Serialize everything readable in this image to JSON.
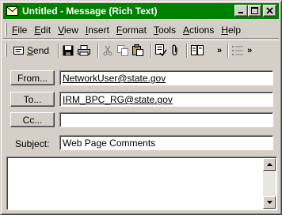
{
  "window": {
    "title": "Untitled - Message (Rich Text)",
    "accent_color": "#008000",
    "controls": {
      "minimize": "_",
      "maximize": "□",
      "close": "×"
    }
  },
  "menu": [
    {
      "key": "file",
      "accel": "F",
      "rest": "ile"
    },
    {
      "key": "edit",
      "accel": "E",
      "rest": "dit"
    },
    {
      "key": "view",
      "accel": "V",
      "rest": "iew"
    },
    {
      "key": "insert",
      "accel": "I",
      "rest": "nsert"
    },
    {
      "key": "format",
      "accel": "F",
      "rest": "ormat"
    },
    {
      "key": "tools",
      "accel": "T",
      "rest": "ools"
    },
    {
      "key": "actions",
      "accel": "A",
      "rest": "ctions"
    },
    {
      "key": "help",
      "accel": "H",
      "rest": "elp"
    }
  ],
  "toolbar": {
    "send_accel": "S",
    "send_rest": "end",
    "overflow_glyph": "»",
    "icons": [
      "save-icon",
      "print-icon",
      "cut-icon",
      "copy-icon",
      "paste-icon",
      "check-names-icon",
      "attach-icon",
      "address-book-icon",
      "bullets-icon"
    ]
  },
  "fields": {
    "from": {
      "button_label": "From...",
      "value": "NetworkUser@state.gov"
    },
    "to": {
      "button_label": "To...",
      "value": "IRM_BPC_RG@state.gov"
    },
    "cc": {
      "button_label": "Cc...",
      "value": ""
    },
    "subject": {
      "label": "Subject:",
      "value": "Web Page Comments"
    }
  },
  "body": {
    "text": ""
  }
}
